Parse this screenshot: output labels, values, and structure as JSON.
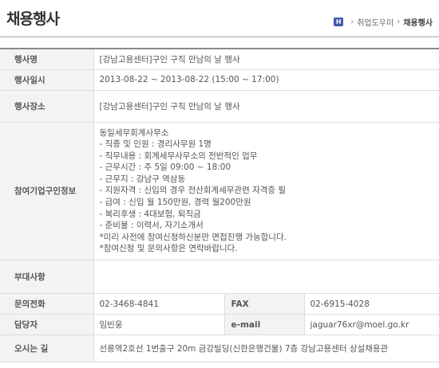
{
  "page": {
    "title": "채용행사",
    "breadcrumb": {
      "home_icon": "H",
      "parent": "취업도우미",
      "current": "채용행사"
    }
  },
  "details": {
    "event_name_label": "행사명",
    "event_name": "[강남고용센터]구인 구직 만남의 날 행사",
    "date_label": "행사일시",
    "date": "2013-08-22 ~ 2013-08-22 (15:00 ~ 17:00)",
    "place_label": "행사장소",
    "place": "[강남고용센터]구인 구직 만남의 날 행사",
    "company_label": "참여기업구인정보",
    "company_lines": [
      "동일세무회계사무소",
      "- 직종 및 인원 : 경리사무원 1명",
      "- 직무내용 : 회계세무사무소의 전반적인 업무",
      "- 근무시간 : 주 5일 09:00 ~ 18:00",
      "- 근무지 : 강남구 역삼동",
      "- 지원자격 : 신입의 경우 전산회계세무관련 자격증 필",
      "- 급여 : 신입 월 150만원, 경력 월200만원",
      "- 복리후생 : 4대보험, 퇴직금",
      "- 준비물 : 이력서, 자기소개서",
      "*미리 사전에 참여신청하신분만 면접진행 가능합니다.",
      "*참여신청 및 문의사항은 연락바랍니다."
    ],
    "extra_label": "부대사항",
    "extra": "",
    "phone_label": "문의전화",
    "phone": "02-3468-4841",
    "fax_label": "FAX",
    "fax": "02-6915-4028",
    "manager_label": "담당자",
    "manager": "임빈웅",
    "email_label": "e-mail",
    "email": "jaguar76xr@moel.go.kr",
    "directions_label": "오시는 길",
    "directions": "선릉역2호선 1번출구 20m 금강빌딩(신한은행건물) 7층 강남고용센터 상설채용관"
  }
}
